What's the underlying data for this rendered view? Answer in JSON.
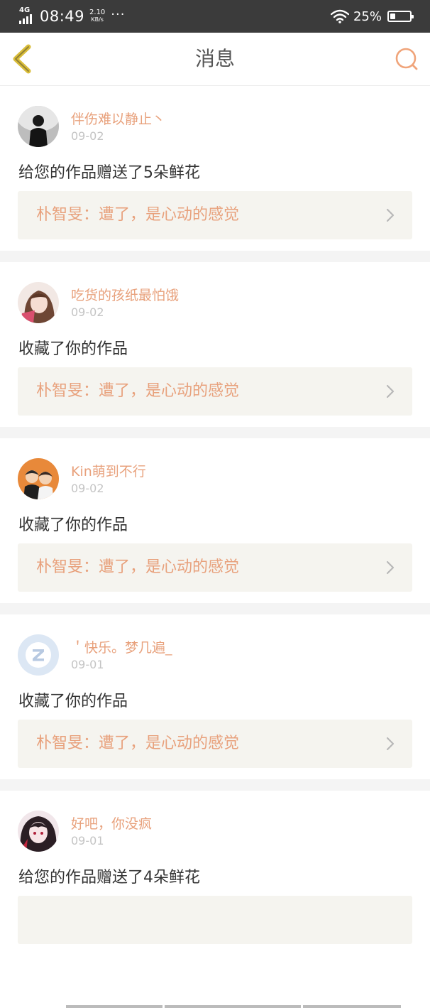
{
  "status_bar": {
    "network": "4G",
    "time": "08:49",
    "speed_value": "2.10",
    "speed_unit": "KB/s",
    "more": "···",
    "battery_text": "25%",
    "battery_level": 0.25
  },
  "nav": {
    "title": "消息",
    "back_icon": "chevron-left-icon",
    "search_icon": "search-icon"
  },
  "colors": {
    "accent": "#e8a17c",
    "back_icon": "#d9bd3a",
    "status_bar_bg": "#3b3b3b",
    "work_bg": "#f5f4ef"
  },
  "messages": [
    {
      "username": "伴伤难以静止丶",
      "date": "09-02",
      "action": "给您的作品赠送了5朵鲜花",
      "work": "朴智旻：遭了，是心动的感觉"
    },
    {
      "username": "吃货的孩纸最怕饿",
      "date": "09-02",
      "action": "收藏了你的作品",
      "work": "朴智旻：遭了，是心动的感觉"
    },
    {
      "username": "Kin萌到不行",
      "date": "09-02",
      "action": "收藏了你的作品",
      "work": "朴智旻：遭了，是心动的感觉"
    },
    {
      "username": "＇快乐。梦几遍_",
      "date": "09-01",
      "action": "收藏了你的作品",
      "work": "朴智旻：遭了，是心动的感觉"
    },
    {
      "username": "好吧，你没疯",
      "date": "09-01",
      "action": "给您的作品赠送了4朵鲜花",
      "work": ""
    }
  ]
}
